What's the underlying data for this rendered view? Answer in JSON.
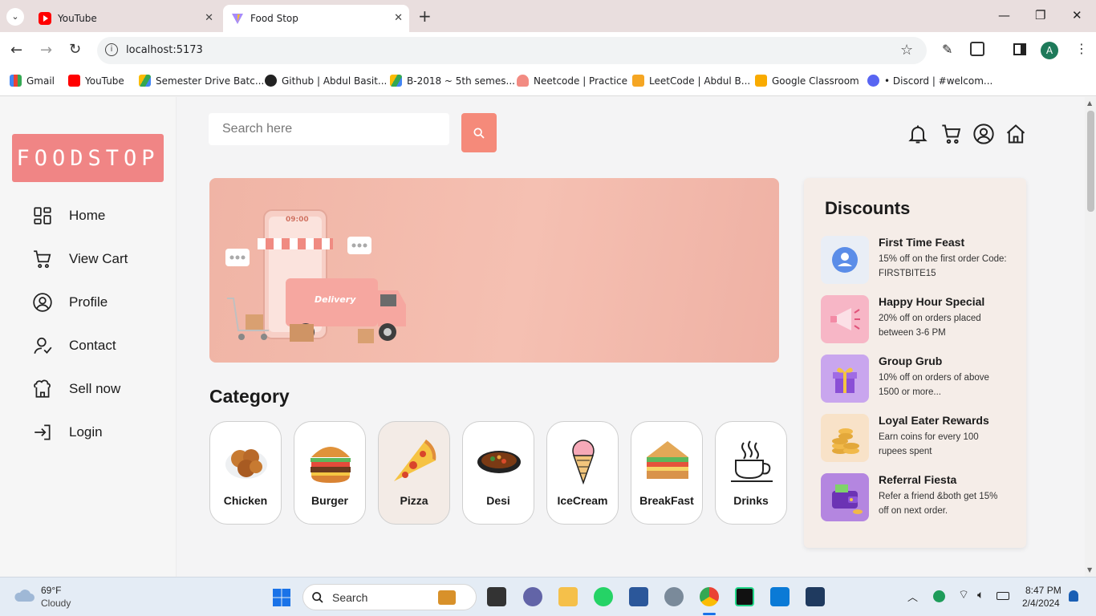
{
  "browser": {
    "tabs": [
      {
        "title": "YouTube",
        "active": false
      },
      {
        "title": "Food Stop",
        "active": true
      }
    ],
    "url": "localhost:5173",
    "bookmarks": [
      "Gmail",
      "YouTube",
      "Semester Drive Batc...",
      "Github | Abdul Basit...",
      "B-2018 ~ 5th semes...",
      "Neetcode | Practice",
      "LeetCode | Abdul B...",
      "Google Classroom",
      "• Discord | #welcom..."
    ],
    "profile_initial": "A"
  },
  "sidebar": {
    "logo": "FOODSTOP",
    "items": [
      {
        "label": "Home",
        "icon": "grid-icon"
      },
      {
        "label": "View Cart",
        "icon": "cart-icon"
      },
      {
        "label": "Profile",
        "icon": "user-circle-icon"
      },
      {
        "label": "Contact",
        "icon": "contact-icon"
      },
      {
        "label": "Sell now",
        "icon": "store-icon"
      },
      {
        "label": "Login",
        "icon": "login-icon"
      }
    ]
  },
  "header": {
    "search_placeholder": "Search here"
  },
  "category": {
    "title": "Category",
    "items": [
      {
        "label": "Chicken"
      },
      {
        "label": "Burger"
      },
      {
        "label": "Pizza"
      },
      {
        "label": "Desi"
      },
      {
        "label": "IceCream"
      },
      {
        "label": "BreakFast"
      },
      {
        "label": "Drinks"
      }
    ],
    "active_index": 2
  },
  "banner": {
    "phone_time": "09:00",
    "truck_text": "Delivery"
  },
  "discounts": {
    "title": "Discounts",
    "items": [
      {
        "title": "First Time Feast",
        "desc": "15% off on the first order Code: FIRSTBITE15"
      },
      {
        "title": "Happy Hour Special",
        "desc": "20% off on orders placed between 3-6 PM"
      },
      {
        "title": "Group Grub",
        "desc": "10% off on orders of above 1500 or more..."
      },
      {
        "title": "Loyal Eater Rewards",
        "desc": "Earn coins for every 100 rupees spent"
      },
      {
        "title": "Referral Fiesta",
        "desc": "Refer a friend &both get 15% off on next order."
      }
    ]
  },
  "taskbar": {
    "weather_temp": "69°F",
    "weather_desc": "Cloudy",
    "search_label": "Search",
    "time": "8:47 PM",
    "date": "2/4/2024"
  },
  "colors": {
    "accent": "#f58a7a",
    "logo_bg": "#f08585",
    "discount_panel": "#f5ede8"
  }
}
